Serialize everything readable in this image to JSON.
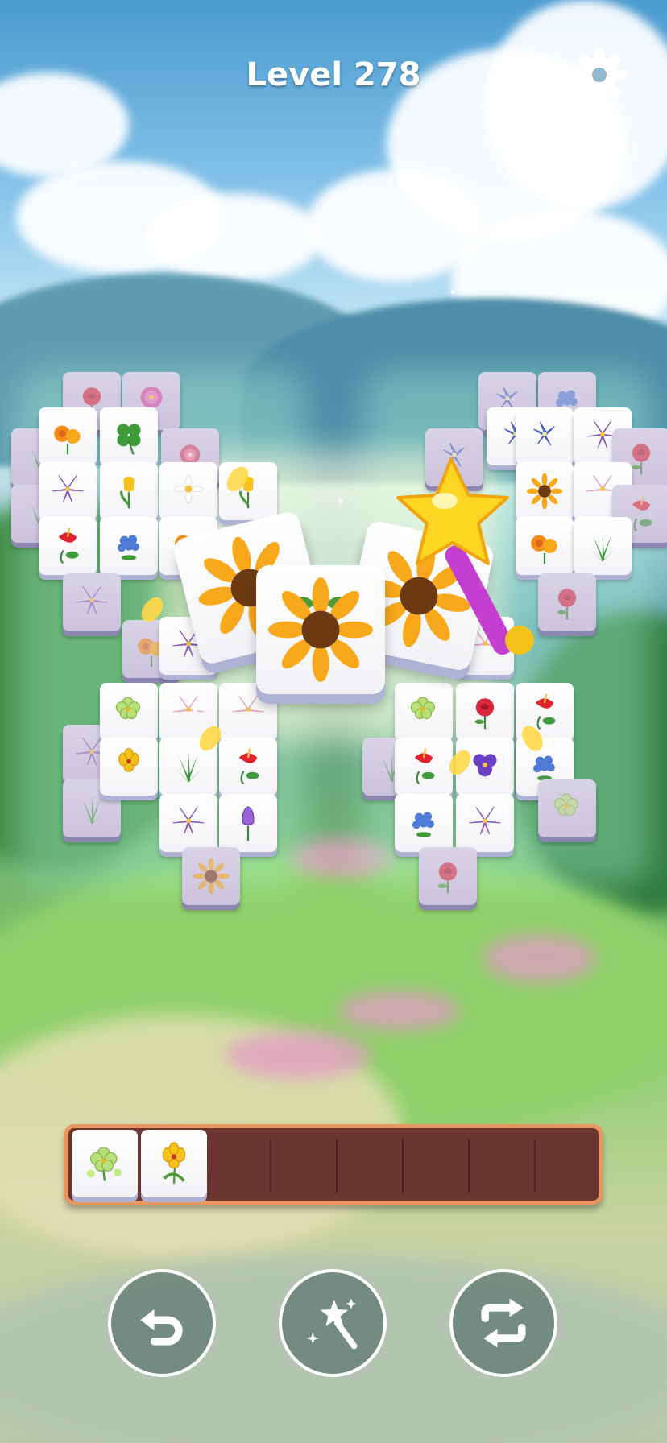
{
  "header": {
    "title": "Level 278",
    "settings_icon": "gear-icon"
  },
  "colors": {
    "tray_fill": "#6b3530",
    "tray_border": "#e99660",
    "tile_face": "#ffffff",
    "tile_edge": "#aeb3d6",
    "title_text": "#ffffff"
  },
  "board": {
    "matched_effect_tiles": [
      "sunflower",
      "sunflower",
      "sunflower"
    ],
    "booster_animation_icon": "magic-wand-icon"
  },
  "tray": {
    "capacity": 7,
    "tiles": [
      "green-clover-flower",
      "yellow-orchid"
    ]
  },
  "tools": [
    {
      "name": "undo",
      "icon": "undo-icon"
    },
    {
      "name": "magic-wand",
      "icon": "magic-wand-icon"
    },
    {
      "name": "shuffle",
      "icon": "shuffle-icon"
    }
  ]
}
